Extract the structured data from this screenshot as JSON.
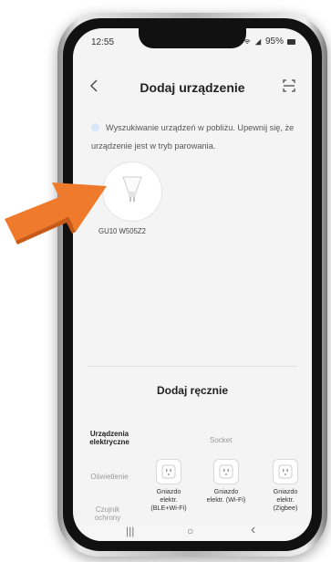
{
  "status": {
    "time": "12:55",
    "battery": "95%"
  },
  "header": {
    "title": "Dodaj urządzenie",
    "back_icon": "chevron-left-icon",
    "scan_icon": "scan-icon"
  },
  "search": {
    "message": "Wyszukiwanie urządzeń w pobliżu. Upewnij się, że urządzenie jest w tryb parowania."
  },
  "found_device": {
    "name": "GU10 W505Z2",
    "icon": "bulb-icon"
  },
  "manual": {
    "title": "Dodaj ręcznie",
    "categories": [
      "Urządzenia elektryczne",
      "Oświetlenie",
      "Czujnik ochrony"
    ],
    "section": "Socket",
    "items": [
      {
        "label": "Gniazdo elektr. (BLE+Wi-Fi)",
        "icon": "socket-icon"
      },
      {
        "label": "Gniazdo elektr. (Wi-Fi)",
        "icon": "socket-icon"
      },
      {
        "label": "Gniazdo elektr. (Zigbee)",
        "icon": "socket-icon"
      }
    ]
  },
  "navbar": {
    "recent": "|||",
    "home": "○",
    "back": "‹"
  },
  "colors": {
    "arrow": "#f07a2b",
    "accent_dot": "#d7e7f7",
    "screen_bg": "#f4f4f4"
  }
}
